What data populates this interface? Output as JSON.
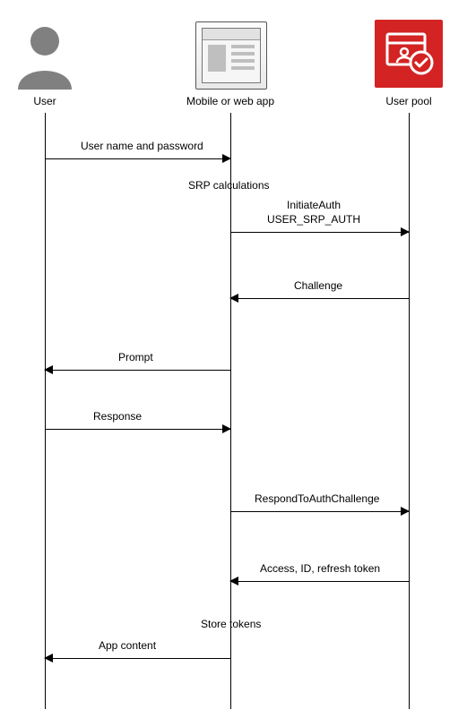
{
  "actors": {
    "user": "User",
    "app": "Mobile or web app",
    "pool": "User pool"
  },
  "messages": {
    "m1": "User name and password",
    "note1": "SRP calculations",
    "m2_line1": "InitiateAuth",
    "m2_line2": "USER_SRP_AUTH",
    "m3": "Challenge",
    "m4": "Prompt",
    "m5": "Response",
    "m6": "RespondToAuthChallenge",
    "m7": "Access, ID, refresh token",
    "note2": "Store tokens",
    "m8": "App content"
  }
}
